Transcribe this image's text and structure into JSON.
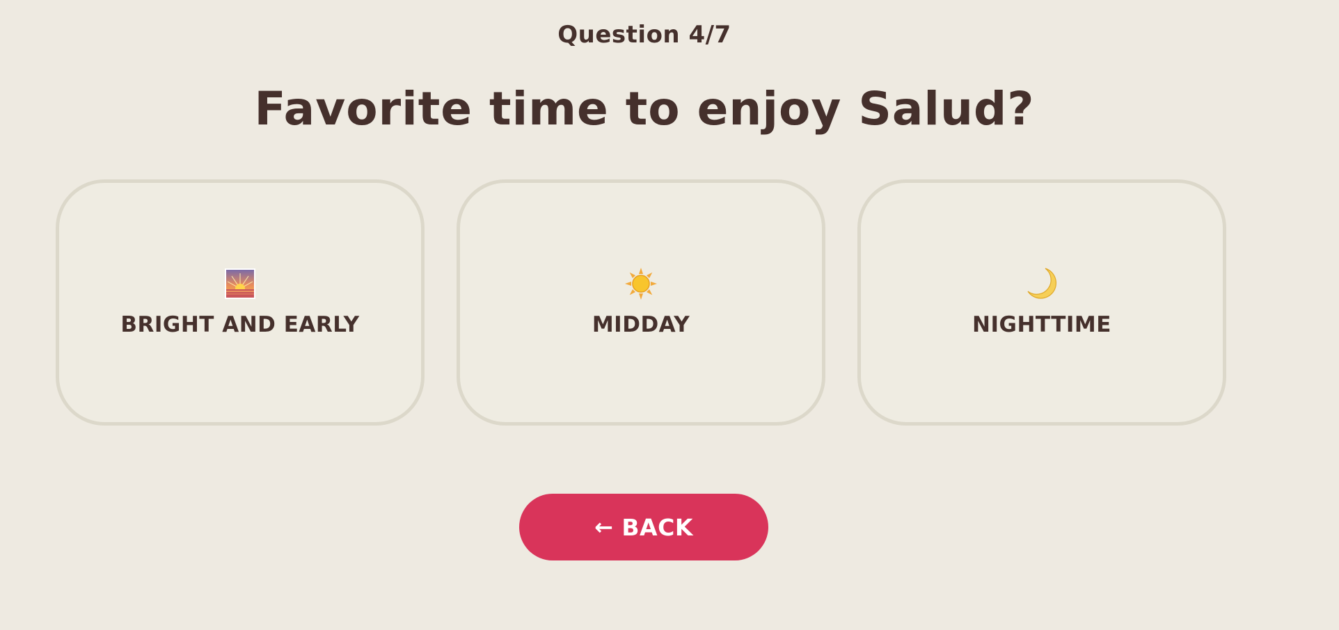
{
  "quiz": {
    "progress_label": "Question 4/7",
    "question": "Favorite time to enjoy Salud?"
  },
  "options": [
    {
      "label": "BRIGHT AND EARLY",
      "icon": "sunrise-icon"
    },
    {
      "label": "MIDDAY",
      "icon": "sun-icon"
    },
    {
      "label": "NIGHTTIME",
      "icon": "crescent-moon-icon"
    }
  ],
  "back_button": {
    "arrow": "←",
    "label": "BACK"
  },
  "colors": {
    "background": "#eeeae1",
    "text": "#45302c",
    "card_border": "#dcd8ca",
    "accent": "#d9345a"
  }
}
